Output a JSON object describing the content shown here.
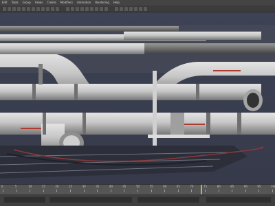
{
  "app": {
    "title": ""
  },
  "menubar": {
    "items": [
      "Edit",
      "Tools",
      "Group",
      "Views",
      "Create",
      "Modifiers",
      "Animation",
      "Rendering",
      "Help"
    ]
  },
  "toolbar": {
    "icons": [
      "undo-icon",
      "redo-icon",
      "link-icon",
      "unlink-icon",
      "bind-icon",
      "select-icon",
      "select-name-icon",
      "rect-select-icon",
      "window-crossing-icon",
      "move-icon",
      "rotate-icon",
      "scale-icon",
      "ref-coord-icon",
      "pivot-icon",
      "snap-icon",
      "angle-snap-icon",
      "percent-snap-icon",
      "spinner-snap-icon",
      "named-sets-icon",
      "mirror-icon",
      "align-icon",
      "layers-icon",
      "curve-editor-icon",
      "schematic-icon",
      "material-editor-icon",
      "render-setup-icon",
      "render-frame-icon",
      "render-icon"
    ]
  },
  "viewport": {
    "label": ""
  },
  "timeline": {
    "ticks": [
      "0",
      "5",
      "10",
      "15",
      "20",
      "25",
      "30",
      "35",
      "40",
      "45",
      "50",
      "55",
      "60",
      "65",
      "70",
      "75",
      "80",
      "85",
      "90",
      "95",
      "100"
    ],
    "current_frame": 71
  },
  "colors": {
    "viewport_bg": "#3b4052",
    "pipe": "#bdbdbd",
    "accent_red": "#b03a2e",
    "playhead": "#b9b93a"
  }
}
